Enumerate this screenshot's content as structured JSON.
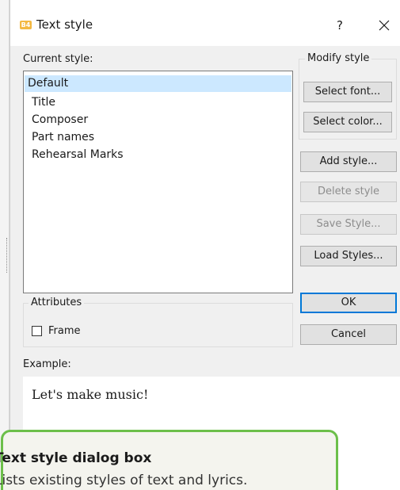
{
  "window": {
    "title": "Text style",
    "app_icon_text": "B4",
    "help_label": "?",
    "close_icon": "close-icon"
  },
  "current_style": {
    "label": "Current style:",
    "items": [
      "Default",
      "Title",
      "Composer",
      "Part names",
      "Rehearsal Marks"
    ],
    "selected_index": 0
  },
  "modify_style": {
    "label": "Modify style",
    "select_font": "Select font...",
    "select_color": "Select color..."
  },
  "actions": {
    "add_style": "Add style...",
    "delete_style": "Delete style",
    "save_style": "Save Style...",
    "load_styles": "Load Styles..."
  },
  "attributes": {
    "label": "Attributes",
    "frame_label": "Frame",
    "frame_checked": false
  },
  "dialog_buttons": {
    "ok": "OK",
    "cancel": "Cancel"
  },
  "example": {
    "label": "Example:",
    "text": "Let's make music!"
  },
  "callout": {
    "title": "Text style dialog box",
    "body": "Lists existing styles of text and lyrics."
  },
  "colors": {
    "accent": "#0078d7",
    "selection": "#cce8ff",
    "callout_border": "#6cbf4a"
  }
}
